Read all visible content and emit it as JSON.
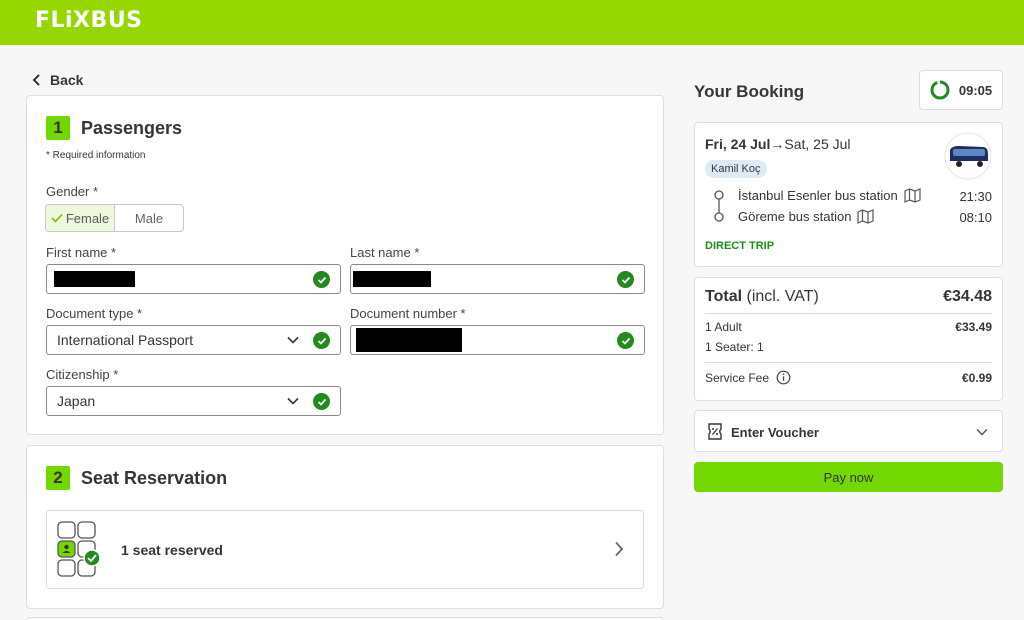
{
  "header": {
    "logo": "FLiXBUS"
  },
  "nav": {
    "back_label": "Back"
  },
  "passengers": {
    "step_number": "1",
    "title": "Passengers",
    "required_note": "* Required information",
    "gender_label": "Gender *",
    "gender_options": [
      "Female",
      "Male"
    ],
    "gender_selected": "Female",
    "first_name_label": "First name *",
    "last_name_label": "Last name *",
    "document_type_label": "Document type *",
    "document_type_value": "International Passport",
    "document_number_label": "Document number *",
    "citizenship_label": "Citizenship *",
    "citizenship_value": "Japan"
  },
  "seat_reservation": {
    "step_number": "2",
    "title": "Seat Reservation",
    "summary": "1 seat reserved"
  },
  "booking": {
    "title": "Your Booking",
    "timer": "09:05",
    "trip": {
      "date_from": "Fri, 24 Jul",
      "arrow": "→",
      "date_to": "Sat, 25 Jul",
      "operator": "Kamil Koç",
      "departure_station": "İstanbul Esenler bus station",
      "departure_time": "21:30",
      "arrival_station": "Göreme bus station",
      "arrival_time": "08:10",
      "trip_type": "DIRECT TRIP"
    },
    "totals": {
      "total_label": "Total",
      "total_note": "(incl. VAT)",
      "total_value": "€34.48",
      "adult_label": "1 Adult",
      "adult_value": "€33.49",
      "seater_label": "1 Seater: 1",
      "service_fee_label": "Service Fee",
      "service_fee_value": "€0.99"
    },
    "voucher_label": "Enter Voucher",
    "pay_label": "Pay now"
  },
  "colors": {
    "brand": "#97d700",
    "accent": "#73d700",
    "success": "#228a1f"
  }
}
